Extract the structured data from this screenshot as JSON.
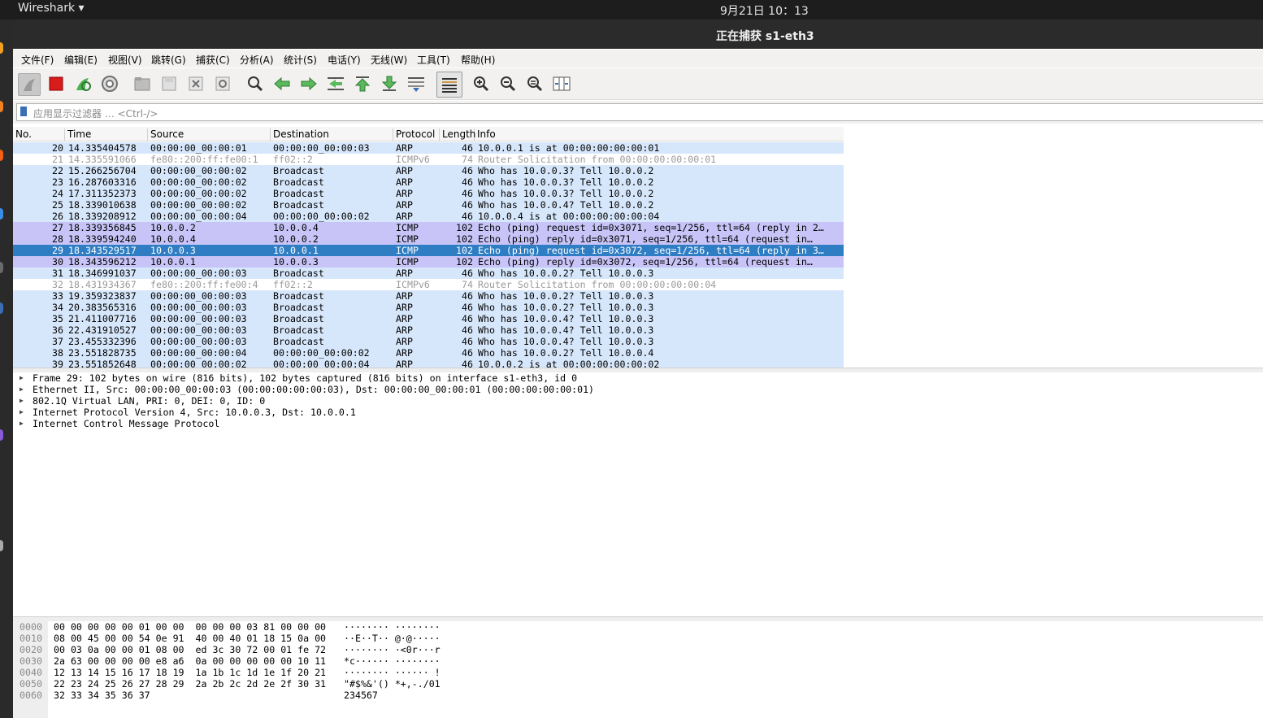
{
  "topbar": {
    "app_name": "Wireshark ▾",
    "clock": "9月21日  10：13"
  },
  "window": {
    "title": "正在捕获 s1-eth3"
  },
  "menu": [
    "文件(F)",
    "编辑(E)",
    "视图(V)",
    "跳转(G)",
    "捕获(C)",
    "分析(A)",
    "统计(S)",
    "电话(Y)",
    "无线(W)",
    "工具(T)",
    "帮助(H)"
  ],
  "filter": {
    "placeholder": "应用显示过滤器 … <Ctrl-/>"
  },
  "columns": {
    "no": "No.",
    "time": "Time",
    "source": "Source",
    "destination": "Destination",
    "protocol": "Protocol",
    "length": "Length",
    "info": "Info"
  },
  "packets": [
    {
      "no": "20",
      "time": "14.335404578",
      "src": "00:00:00_00:00:01",
      "dst": "00:00:00_00:00:03",
      "proto": "ARP",
      "len": "46",
      "info": "10.0.0.1 is at 00:00:00:00:00:01",
      "cls": "arp"
    },
    {
      "no": "21",
      "time": "14.335591066",
      "src": "fe80::200:ff:fe00:1",
      "dst": "ff02::2",
      "proto": "ICMPv6",
      "len": "74",
      "info": "Router Solicitation from 00:00:00:00:00:01",
      "cls": "icmpv6"
    },
    {
      "no": "22",
      "time": "15.266256704",
      "src": "00:00:00_00:00:02",
      "dst": "Broadcast",
      "proto": "ARP",
      "len": "46",
      "info": "Who has 10.0.0.3? Tell 10.0.0.2",
      "cls": "arp"
    },
    {
      "no": "23",
      "time": "16.287603316",
      "src": "00:00:00_00:00:02",
      "dst": "Broadcast",
      "proto": "ARP",
      "len": "46",
      "info": "Who has 10.0.0.3? Tell 10.0.0.2",
      "cls": "arp"
    },
    {
      "no": "24",
      "time": "17.311352373",
      "src": "00:00:00_00:00:02",
      "dst": "Broadcast",
      "proto": "ARP",
      "len": "46",
      "info": "Who has 10.0.0.3? Tell 10.0.0.2",
      "cls": "arp"
    },
    {
      "no": "25",
      "time": "18.339010638",
      "src": "00:00:00_00:00:02",
      "dst": "Broadcast",
      "proto": "ARP",
      "len": "46",
      "info": "Who has 10.0.0.4? Tell 10.0.0.2",
      "cls": "arp"
    },
    {
      "no": "26",
      "time": "18.339208912",
      "src": "00:00:00_00:00:04",
      "dst": "00:00:00_00:00:02",
      "proto": "ARP",
      "len": "46",
      "info": "10.0.0.4 is at 00:00:00:00:00:04",
      "cls": "arp"
    },
    {
      "no": "27",
      "time": "18.339356845",
      "src": "10.0.0.2",
      "dst": "10.0.0.4",
      "proto": "ICMP",
      "len": "102",
      "info": "Echo (ping) request  id=0x3071, seq=1/256, ttl=64 (reply in 2…",
      "cls": "icmp"
    },
    {
      "no": "28",
      "time": "18.339594240",
      "src": "10.0.0.4",
      "dst": "10.0.0.2",
      "proto": "ICMP",
      "len": "102",
      "info": "Echo (ping) reply    id=0x3071, seq=1/256, ttl=64 (request in…",
      "cls": "icmp"
    },
    {
      "no": "29",
      "time": "18.343529517",
      "src": "10.0.0.3",
      "dst": "10.0.0.1",
      "proto": "ICMP",
      "len": "102",
      "info": "Echo (ping) request  id=0x3072, seq=1/256, ttl=64 (reply in 3…",
      "cls": "sel"
    },
    {
      "no": "30",
      "time": "18.343596212",
      "src": "10.0.0.1",
      "dst": "10.0.0.3",
      "proto": "ICMP",
      "len": "102",
      "info": "Echo (ping) reply    id=0x3072, seq=1/256, ttl=64 (request in…",
      "cls": "icmp"
    },
    {
      "no": "31",
      "time": "18.346991037",
      "src": "00:00:00_00:00:03",
      "dst": "Broadcast",
      "proto": "ARP",
      "len": "46",
      "info": "Who has 10.0.0.2? Tell 10.0.0.3",
      "cls": "arp"
    },
    {
      "no": "32",
      "time": "18.431934367",
      "src": "fe80::200:ff:fe00:4",
      "dst": "ff02::2",
      "proto": "ICMPv6",
      "len": "74",
      "info": "Router Solicitation from 00:00:00:00:00:04",
      "cls": "icmpv6"
    },
    {
      "no": "33",
      "time": "19.359323837",
      "src": "00:00:00_00:00:03",
      "dst": "Broadcast",
      "proto": "ARP",
      "len": "46",
      "info": "Who has 10.0.0.2? Tell 10.0.0.3",
      "cls": "arp"
    },
    {
      "no": "34",
      "time": "20.383565316",
      "src": "00:00:00_00:00:03",
      "dst": "Broadcast",
      "proto": "ARP",
      "len": "46",
      "info": "Who has 10.0.0.2? Tell 10.0.0.3",
      "cls": "arp"
    },
    {
      "no": "35",
      "time": "21.411007716",
      "src": "00:00:00_00:00:03",
      "dst": "Broadcast",
      "proto": "ARP",
      "len": "46",
      "info": "Who has 10.0.0.4? Tell 10.0.0.3",
      "cls": "arp"
    },
    {
      "no": "36",
      "time": "22.431910527",
      "src": "00:00:00_00:00:03",
      "dst": "Broadcast",
      "proto": "ARP",
      "len": "46",
      "info": "Who has 10.0.0.4? Tell 10.0.0.3",
      "cls": "arp"
    },
    {
      "no": "37",
      "time": "23.455332396",
      "src": "00:00:00_00:00:03",
      "dst": "Broadcast",
      "proto": "ARP",
      "len": "46",
      "info": "Who has 10.0.0.4? Tell 10.0.0.3",
      "cls": "arp"
    },
    {
      "no": "38",
      "time": "23.551828735",
      "src": "00:00:00_00:00:04",
      "dst": "00:00:00_00:00:02",
      "proto": "ARP",
      "len": "46",
      "info": "Who has 10.0.0.2? Tell 10.0.0.4",
      "cls": "arp"
    },
    {
      "no": "39",
      "time": "23.551852648",
      "src": "00:00:00_00:00:02",
      "dst": "00:00:00_00:00:04",
      "proto": "ARP",
      "len": "46",
      "info": "10.0.0.2 is at 00:00:00:00:00:02",
      "cls": "arp"
    }
  ],
  "details": [
    "Frame 29: 102 bytes on wire (816 bits), 102 bytes captured (816 bits) on interface s1-eth3, id 0",
    "Ethernet II, Src: 00:00:00_00:00:03 (00:00:00:00:00:03), Dst: 00:00:00_00:00:01 (00:00:00:00:00:01)",
    "802.1Q Virtual LAN, PRI: 0, DEI: 0, ID: 0",
    "Internet Protocol Version 4, Src: 10.0.0.3, Dst: 10.0.0.1",
    "Internet Control Message Protocol"
  ],
  "bytes": [
    {
      "off": "0000",
      "hex": "00 00 00 00 00 01 00 00  00 00 00 03 81 00 00 00",
      "ascii": "········ ········"
    },
    {
      "off": "0010",
      "hex": "08 00 45 00 00 54 0e 91  40 00 40 01 18 15 0a 00",
      "ascii": "··E··T·· @·@·····"
    },
    {
      "off": "0020",
      "hex": "00 03 0a 00 00 01 08 00  ed 3c 30 72 00 01 fe 72",
      "ascii": "········ ·<0r···r"
    },
    {
      "off": "0030",
      "hex": "2a 63 00 00 00 00 e8 a6  0a 00 00 00 00 00 10 11",
      "ascii": "*c······ ········"
    },
    {
      "off": "0040",
      "hex": "12 13 14 15 16 17 18 19  1a 1b 1c 1d 1e 1f 20 21",
      "ascii": "········ ······ !"
    },
    {
      "off": "0050",
      "hex": "22 23 24 25 26 27 28 29  2a 2b 2c 2d 2e 2f 30 31",
      "ascii": "\"#$%&'() *+,-./01"
    },
    {
      "off": "0060",
      "hex": "32 33 34 35 36 37",
      "ascii": "234567"
    }
  ],
  "colors": {
    "arp_row": "#d7e7fb",
    "icmp_row": "#c8c4f7",
    "selected_row": "#2f7ec3",
    "stop_button": "#d81b1b"
  },
  "toolbar_icons": [
    "shark-fin-start-icon",
    "stop-capture-icon",
    "restart-capture-icon",
    "capture-options-icon",
    "open-file-icon",
    "save-file-icon",
    "close-file-icon",
    "reload-file-icon",
    "find-packet-icon",
    "go-back-icon",
    "go-forward-icon",
    "go-to-packet-icon",
    "go-first-icon",
    "go-last-icon",
    "auto-scroll-icon",
    "colorize-icon",
    "zoom-in-icon",
    "zoom-out-icon",
    "zoom-normal-icon",
    "resize-columns-icon"
  ]
}
